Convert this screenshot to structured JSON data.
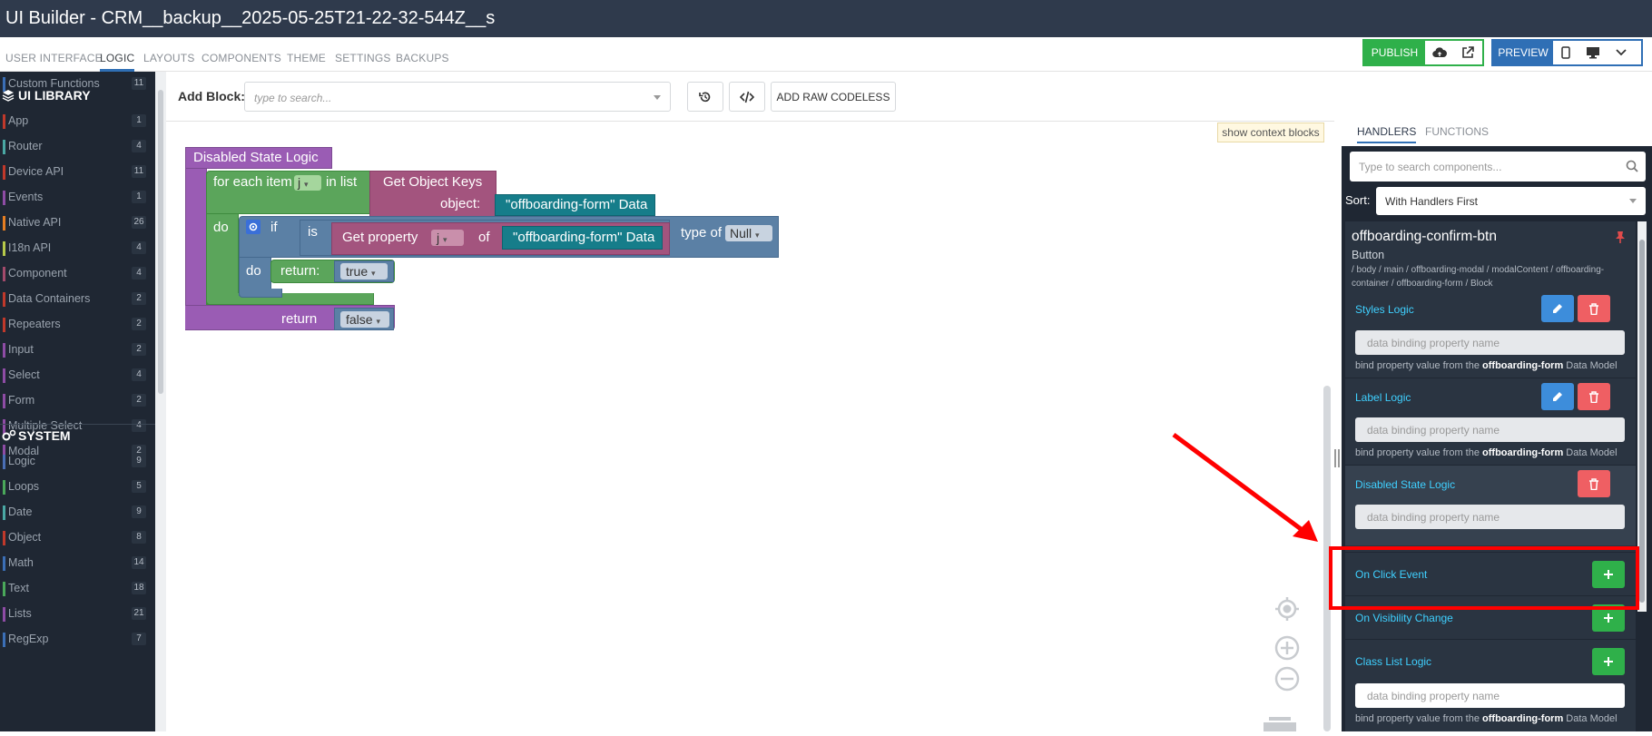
{
  "window": {
    "title": "UI Builder - CRM__backup__2025-05-25T21-22-32-544Z__s"
  },
  "topnav": {
    "tabs": [
      "USER INTERFACE",
      "LOGIC",
      "LAYOUTS",
      "COMPONENTS",
      "THEME",
      "SETTINGS",
      "BACKUPS"
    ],
    "active": "LOGIC",
    "publish_label": "PUBLISH",
    "preview_label": "PREVIEW"
  },
  "sidebar": {
    "custom_functions": {
      "label": "Custom Functions",
      "count": "11",
      "color": "#3b6fb6"
    },
    "ui_library_title": "UI LIBRARY",
    "ui_library": [
      {
        "label": "App",
        "count": "1",
        "color": "#c0392b"
      },
      {
        "label": "Router",
        "count": "4",
        "color": "#4aa8a4"
      },
      {
        "label": "Device API",
        "count": "11",
        "color": "#c0392b"
      },
      {
        "label": "Events",
        "count": "1",
        "color": "#8e4ca5"
      },
      {
        "label": "Native API",
        "count": "26",
        "color": "#e67e22"
      },
      {
        "label": "I18n API",
        "count": "4",
        "color": "#b6c94a"
      },
      {
        "label": "Component",
        "count": "4",
        "color": "#a24a6b"
      },
      {
        "label": "Data Containers",
        "count": "2",
        "color": "#c0392b"
      },
      {
        "label": "Repeaters",
        "count": "2",
        "color": "#c0392b"
      },
      {
        "label": "Input",
        "count": "2",
        "color": "#8e4ca5"
      },
      {
        "label": "Select",
        "count": "4",
        "color": "#8e4ca5"
      },
      {
        "label": "Form",
        "count": "2",
        "color": "#8e4ca5"
      },
      {
        "label": "Multiple Select",
        "count": "4",
        "color": "#8e4ca5"
      },
      {
        "label": "Modal",
        "count": "2",
        "color": "#8e4ca5"
      }
    ],
    "system_title": "SYSTEM",
    "system": [
      {
        "label": "Logic",
        "count": "9",
        "color": "#4a6fb6"
      },
      {
        "label": "Loops",
        "count": "5",
        "color": "#4aa85a"
      },
      {
        "label": "Date",
        "count": "9",
        "color": "#4aa8a4"
      },
      {
        "label": "Object",
        "count": "8",
        "color": "#c0392b"
      },
      {
        "label": "Math",
        "count": "14",
        "color": "#3b6fb6"
      },
      {
        "label": "Text",
        "count": "18",
        "color": "#4aa85a"
      },
      {
        "label": "Lists",
        "count": "21",
        "color": "#8e4ca5"
      },
      {
        "label": "RegExp",
        "count": "7",
        "color": "#3b6fb6"
      }
    ]
  },
  "toolbar": {
    "add_block_label": "Add Block:",
    "search_placeholder": "type to search...",
    "raw_label": "ADD RAW CODELESS"
  },
  "canvas": {
    "context_label": "show context blocks",
    "blocks": {
      "root": "Disabled State Logic",
      "for_each": "for each item",
      "var_j": "j",
      "in_list": "in list",
      "get_keys": "Get Object Keys",
      "object": "object:",
      "data1": "\"offboarding-form\" Data",
      "do": "do",
      "if": "if",
      "is": "is",
      "get_property": "Get property",
      "of": "of",
      "data2": "\"offboarding-form\" Data",
      "type_of": "type of",
      "null": "Null",
      "do2": "do",
      "return1": "return:",
      "true": "true",
      "return2": "return",
      "false": "false"
    }
  },
  "right_panel": {
    "tabs": [
      "HANDLERS",
      "FUNCTIONS"
    ],
    "active": "HANDLERS",
    "search_placeholder": "Type to search components...",
    "sort_label": "Sort:",
    "sort_value": "With Handlers First",
    "component": {
      "name": "offboarding-confirm-btn",
      "type": "Button",
      "path": "/ body / main / offboarding-modal / modalContent / offboarding-container / offboarding-form / Block"
    },
    "handlers": [
      {
        "title": "Styles Logic",
        "placeholder": "data binding property name",
        "note_prefix": "bind property value from the",
        "note_model": "offboarding-form",
        "note_suffix": "Data Model"
      },
      {
        "title": "Label Logic",
        "placeholder": "data binding property name",
        "note_prefix": "bind property value from the",
        "note_model": "offboarding-form",
        "note_suffix": "Data Model"
      },
      {
        "title": "Disabled State Logic",
        "placeholder": "data binding property name"
      },
      {
        "title": "On Click Event"
      },
      {
        "title": "On Visibility Change"
      },
      {
        "title": "Class List Logic",
        "placeholder": "data binding property name",
        "note_prefix": "bind property value from the",
        "note_model": "offboarding-form",
        "note_suffix": "Data Model"
      }
    ]
  },
  "colors": {
    "accent": "#2f6fb5",
    "publish": "#2fb04a",
    "handler_title": "#3fd0ff",
    "annotation": "#ff0000"
  }
}
